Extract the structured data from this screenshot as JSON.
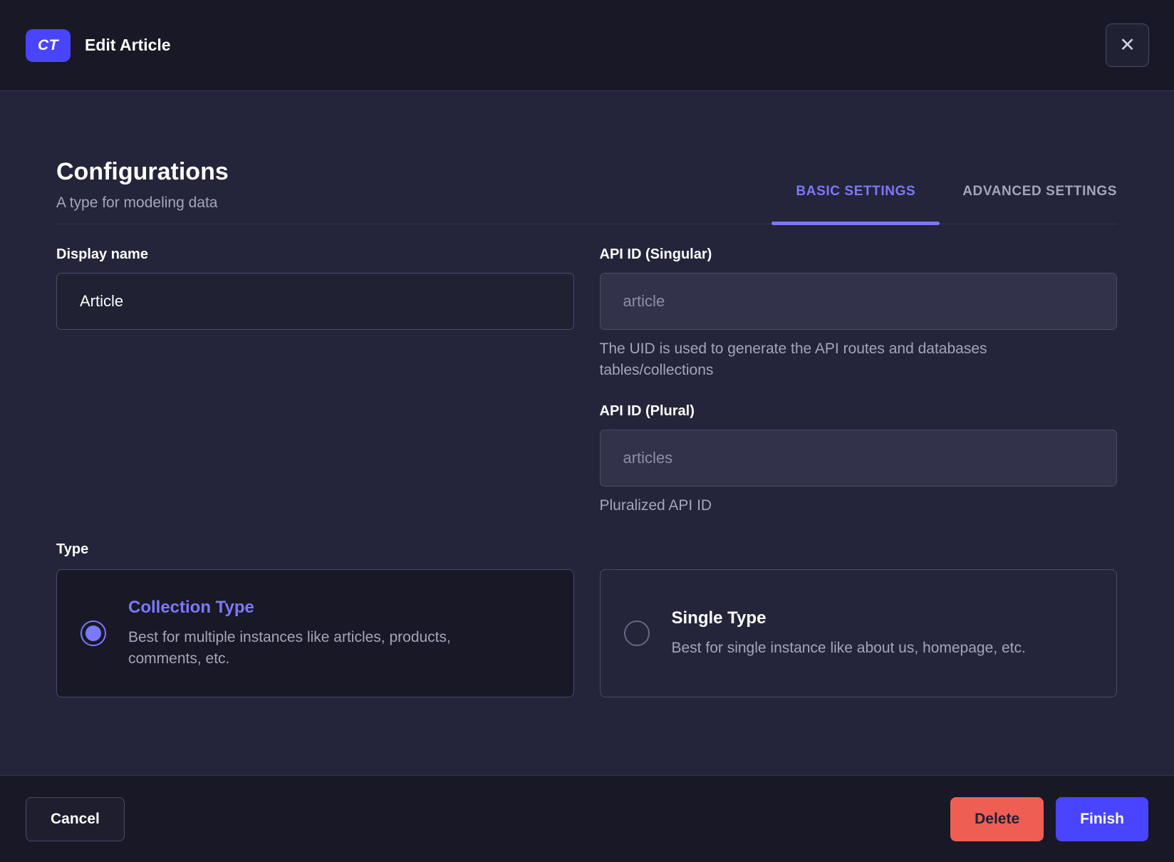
{
  "header": {
    "badge": "CT",
    "title": "Edit Article",
    "close_glyph": "✕"
  },
  "intro": {
    "title": "Configurations",
    "subtitle": "A type for modeling data"
  },
  "tabs": [
    {
      "label": "BASIC SETTINGS",
      "active": true
    },
    {
      "label": "ADVANCED SETTINGS",
      "active": false
    }
  ],
  "form": {
    "display_name": {
      "label": "Display name",
      "value": "Article"
    },
    "api_id_singular": {
      "label": "API ID (Singular)",
      "value": "article",
      "hint": "The UID is used to generate the API routes and databases tables/collections"
    },
    "api_id_plural": {
      "label": "API ID (Plural)",
      "value": "articles",
      "hint": "Pluralized API ID"
    },
    "type": {
      "label": "Type",
      "options": [
        {
          "title": "Collection Type",
          "description": "Best for multiple instances like articles, products, comments, etc.",
          "selected": true
        },
        {
          "title": "Single Type",
          "description": "Best for single instance like about us, homepage, etc.",
          "selected": false
        }
      ]
    }
  },
  "footer": {
    "cancel_label": "Cancel",
    "delete_label": "Delete",
    "finish_label": "Finish"
  },
  "colors": {
    "accent": "#4945ff",
    "accent_text": "#7b79ff",
    "danger": "#ee5e52",
    "header_bg": "#181826",
    "body_bg": "#24243a"
  }
}
